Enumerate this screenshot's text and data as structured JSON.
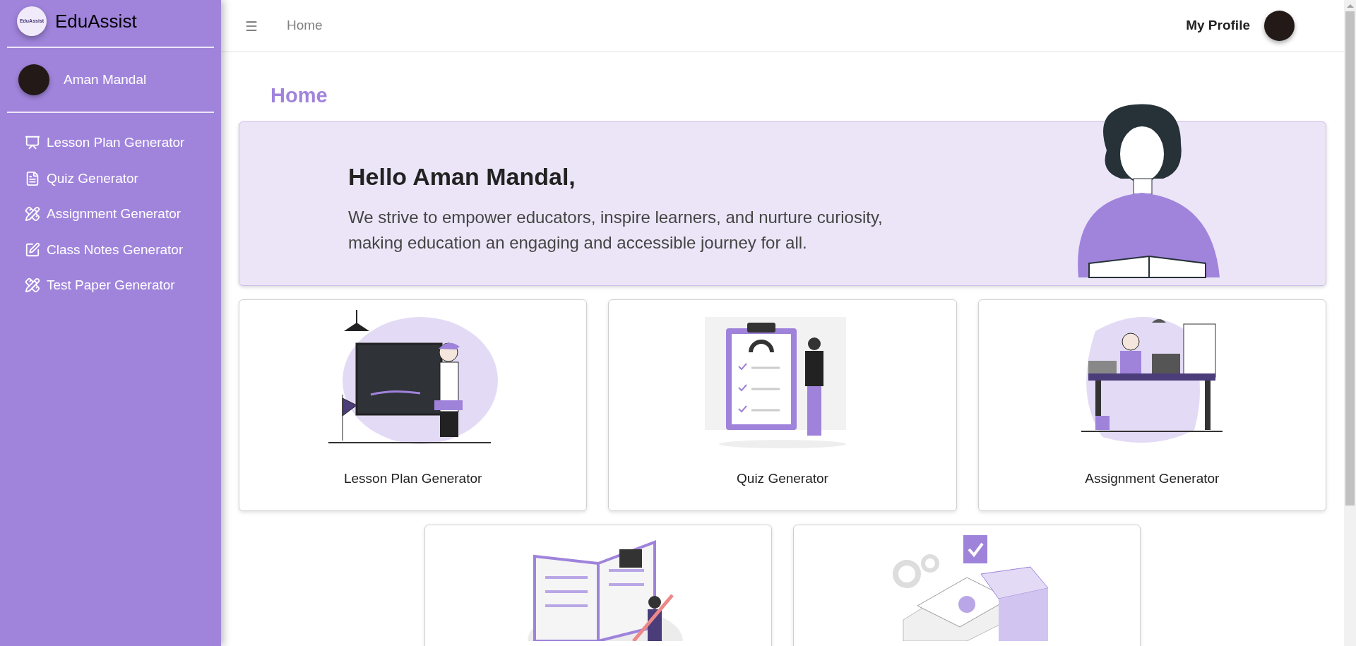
{
  "sidebar": {
    "brand": {
      "badge": "EduAssist",
      "name": "EduAssist"
    },
    "user": {
      "name": "Aman Mandal"
    },
    "items": [
      {
        "label": "Lesson Plan Generator",
        "kind": "teacher",
        "selected": false
      },
      {
        "label": "Quiz Generator",
        "kind": "file",
        "selected": false
      },
      {
        "label": "Assignment Generator",
        "kind": "compass",
        "selected": false
      },
      {
        "label": "Class Notes Generator",
        "kind": "edit",
        "selected": false
      },
      {
        "label": "Test Paper Generator",
        "kind": "compass",
        "selected": false
      }
    ]
  },
  "header": {
    "breadcrumb": "Home",
    "profile_label": "My Profile"
  },
  "page": {
    "title": "Home",
    "hero": {
      "greeting": "Hello Aman Mandal,",
      "message": "We strive to empower educators, inspire learners, and nurture curiosity, making education an engaging and accessible journey for all."
    },
    "cards": [
      {
        "kind": "teacher",
        "title": "Lesson Plan Generator"
      },
      {
        "kind": "quiz",
        "title": "Quiz Generator"
      },
      {
        "kind": "desk",
        "title": "Assignment Generator"
      },
      {
        "kind": "notes"
      },
      {
        "kind": "research"
      }
    ]
  }
}
